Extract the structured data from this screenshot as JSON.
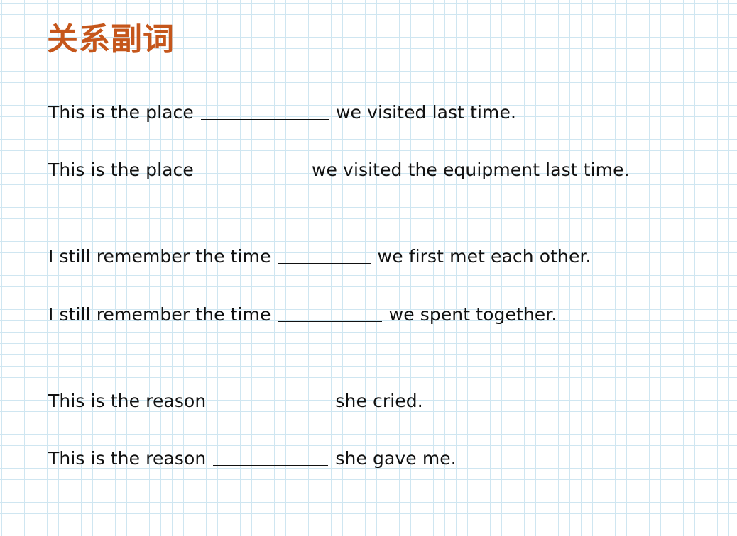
{
  "title": "关系副词",
  "sentences": [
    {
      "before": "This is the place",
      "after": "we visited last time."
    },
    {
      "before": "This is the place",
      "after": "we visited the equipment last time."
    },
    {
      "before": "I still remember the time",
      "after": "we first met each other."
    },
    {
      "before": "I still remember the time",
      "after": "we spent together."
    },
    {
      "before": "This is the reason",
      "after": "she cried."
    },
    {
      "before": "This is the reason",
      "after": "she gave me."
    }
  ]
}
